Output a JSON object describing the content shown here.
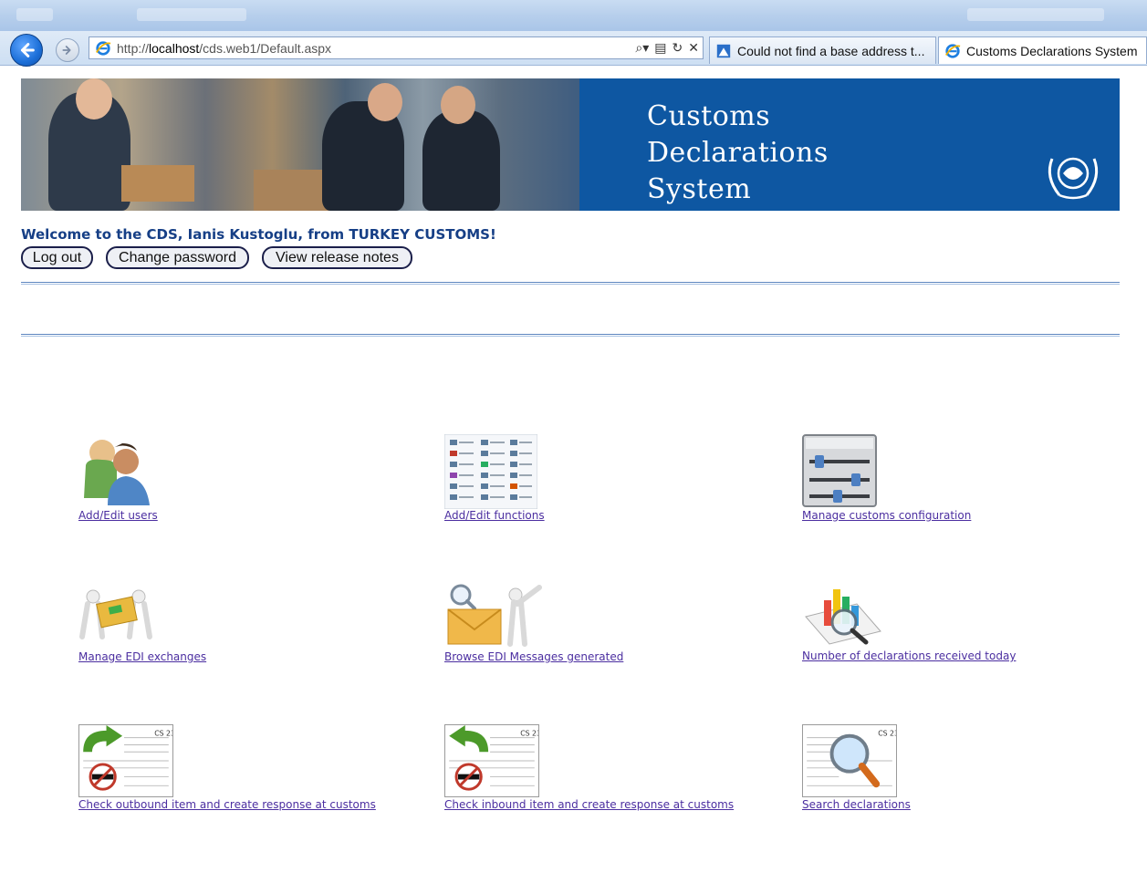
{
  "browser": {
    "url_prefix": "http://",
    "url_host": "localhost",
    "url_path": "/cds.web1/Default.aspx",
    "tabs": [
      {
        "label": "Could not find a base address t..."
      },
      {
        "label": "Customs Declarations System"
      }
    ],
    "search_icon": "search-icon",
    "compat_icon": "compatibility-view-icon",
    "refresh_icon": "refresh-icon",
    "stop_icon": "stop-icon"
  },
  "banner": {
    "title_lines": [
      "Customs",
      "Declarations",
      "System"
    ],
    "brand_color": "#0e57a2"
  },
  "welcome": {
    "text": "Welcome to the CDS, Ianis Kustoglu, from TURKEY CUSTOMS!"
  },
  "actions": {
    "logout": "Log out",
    "change_password": "Change password",
    "release_notes": "View release notes"
  },
  "tiles": [
    {
      "label": "Add/Edit users",
      "icon": "users-icon"
    },
    {
      "label": "Add/Edit functions",
      "icon": "functions-grid-icon"
    },
    {
      "label": "Manage customs configuration",
      "icon": "sliders-icon"
    },
    {
      "label": "Manage EDI exchanges",
      "icon": "edi-exchange-icon"
    },
    {
      "label": "Browse EDI Messages generated",
      "icon": "envelope-search-icon"
    },
    {
      "label": "Number of declarations received today",
      "icon": "chart-magnifier-icon"
    },
    {
      "label": "Check outbound item and create response at customs",
      "icon": "outbound-form-icon"
    },
    {
      "label": "Check inbound item and create response at customs",
      "icon": "inbound-form-icon"
    },
    {
      "label": "Search declarations",
      "icon": "search-form-icon"
    }
  ]
}
